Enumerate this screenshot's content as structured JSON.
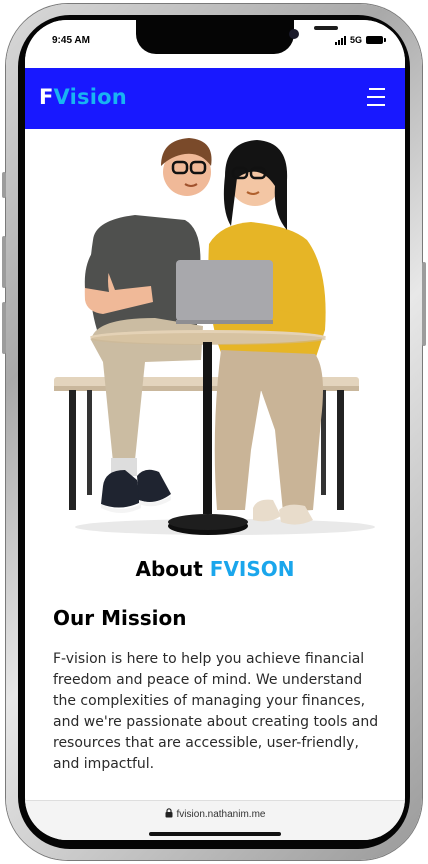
{
  "status_bar": {
    "time": "9:45 AM",
    "network": "5G",
    "signal_icon": "signal-bars-icon",
    "battery_icon": "battery-icon"
  },
  "header": {
    "logo_part1": "F",
    "logo_part2": "Vision",
    "menu_icon": "hamburger-menu-icon",
    "background_color": "#1818ff",
    "logo_accent_color": "#18b4f2"
  },
  "about": {
    "heading_prefix": "About ",
    "heading_accent": "FVISON",
    "accent_color": "#1aa6ec"
  },
  "mission": {
    "title": "Our Mission",
    "text": "F-vision is here to help you achieve financial freedom and peace of mind. We understand the complexities of managing your finances, and we're passionate about creating tools and resources that are accessible, user-friendly, and impactful."
  },
  "browser": {
    "url": "fvision.nathanim.me",
    "lock_icon": "lock-icon"
  }
}
